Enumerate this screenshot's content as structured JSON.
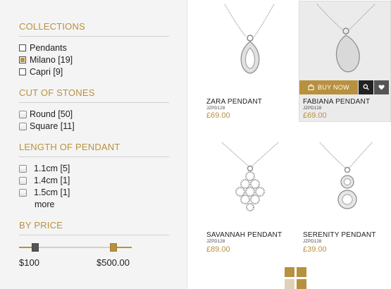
{
  "filters": {
    "collections": {
      "title": "COLLECTIONS",
      "options": [
        {
          "label": "Pendants",
          "checked": false
        },
        {
          "label": "Milano [19]",
          "checked": true
        },
        {
          "label": "Capri [9]",
          "checked": false
        }
      ]
    },
    "cut_of_stones": {
      "title": "CUT OF STONES",
      "options": [
        {
          "label": "Round [50]",
          "checked": false
        },
        {
          "label": "Square [11]",
          "checked": false
        }
      ]
    },
    "length_of_pendant": {
      "title": "LENGTH OF PENDANT",
      "options": [
        {
          "label": "1.1cm [5]",
          "checked": false
        },
        {
          "label": "1.4cm [1]",
          "checked": false
        },
        {
          "label": "1.5cm [1]",
          "checked": false
        }
      ],
      "more_label": "more"
    },
    "by_price": {
      "title": "BY PRICE",
      "min_label": "$100",
      "max_label": "$500.00"
    }
  },
  "products": [
    {
      "name": "ZARA PENDANT",
      "code": "JZPD128",
      "price": "£69.00"
    },
    {
      "name": "FABIANA PENDANT",
      "code": "JZPD128",
      "price": "£69.00"
    },
    {
      "name": "SAVANNAH PENDANT",
      "code": "JZPD128",
      "price": "£89.00"
    },
    {
      "name": "SERENITY PENDANT",
      "code": "JZPD128",
      "price": "£39.00"
    }
  ],
  "actions": {
    "buy_now_label": "BUY NOW",
    "search_icon": "magnifier-icon",
    "wishlist_icon": "heart-icon",
    "grid_icon": "grid-view-icon"
  },
  "colors": {
    "accent": "#b8913f",
    "dark": "#333333"
  }
}
